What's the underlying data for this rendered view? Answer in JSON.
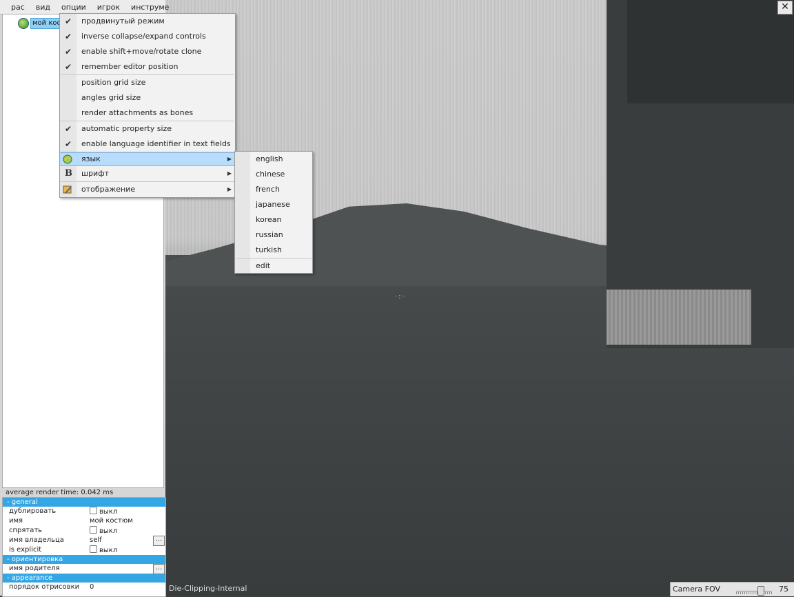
{
  "menubar": [
    "рас",
    "вид",
    "опции",
    "игрок",
    "инструме"
  ],
  "tree": {
    "root_label": "мой кост"
  },
  "options_menu": {
    "items": [
      {
        "label": "продвинутый режим",
        "checked": true
      },
      {
        "label": "inverse collapse/expand controls",
        "checked": true
      },
      {
        "label": "enable shift+move/rotate clone",
        "checked": true
      },
      {
        "label": "remember editor position",
        "checked": true
      },
      {
        "label": "position grid size",
        "checked": false
      },
      {
        "label": "angles grid size",
        "checked": false
      },
      {
        "label": "render attachments as bones",
        "checked": false
      },
      {
        "label": "automatic property size",
        "checked": true
      },
      {
        "label": "enable language identifier in text fields",
        "checked": true
      },
      {
        "label": "язык",
        "icon": "globe-icon",
        "submenu": true,
        "highlighted": true
      },
      {
        "label": "шрифт",
        "icon": "bold-font-icon",
        "submenu": true
      },
      {
        "label": "отображение",
        "icon": "paint-brush-icon",
        "submenu": true
      }
    ]
  },
  "language_submenu": [
    "english",
    "chinese",
    "french",
    "japanese",
    "korean",
    "russian",
    "turkish",
    "edit"
  ],
  "status": {
    "render_time": "average render time: 0.042 ms"
  },
  "properties": {
    "sections": [
      "- general",
      "- ориентировка",
      "- appearance"
    ],
    "rows": [
      {
        "key": "дублировать",
        "value": "выкл",
        "checkbox": true
      },
      {
        "key": "имя",
        "value": "мой костюм"
      },
      {
        "key": "спрятать",
        "value": "выкл",
        "checkbox": true
      },
      {
        "key": "имя владельца",
        "value": "self",
        "button": "..."
      },
      {
        "key": "is explicit",
        "value": "выкл",
        "checkbox": true
      },
      {
        "key": "имя родителя",
        "value": "",
        "button": "..."
      },
      {
        "key": "порядок отрисовки",
        "value": "0"
      }
    ]
  },
  "viewport": {
    "label": "Die-Clipping-Internal",
    "close": "✕"
  },
  "camera": {
    "label": "Camera FOV",
    "value": "75",
    "fraction": 0.68
  }
}
